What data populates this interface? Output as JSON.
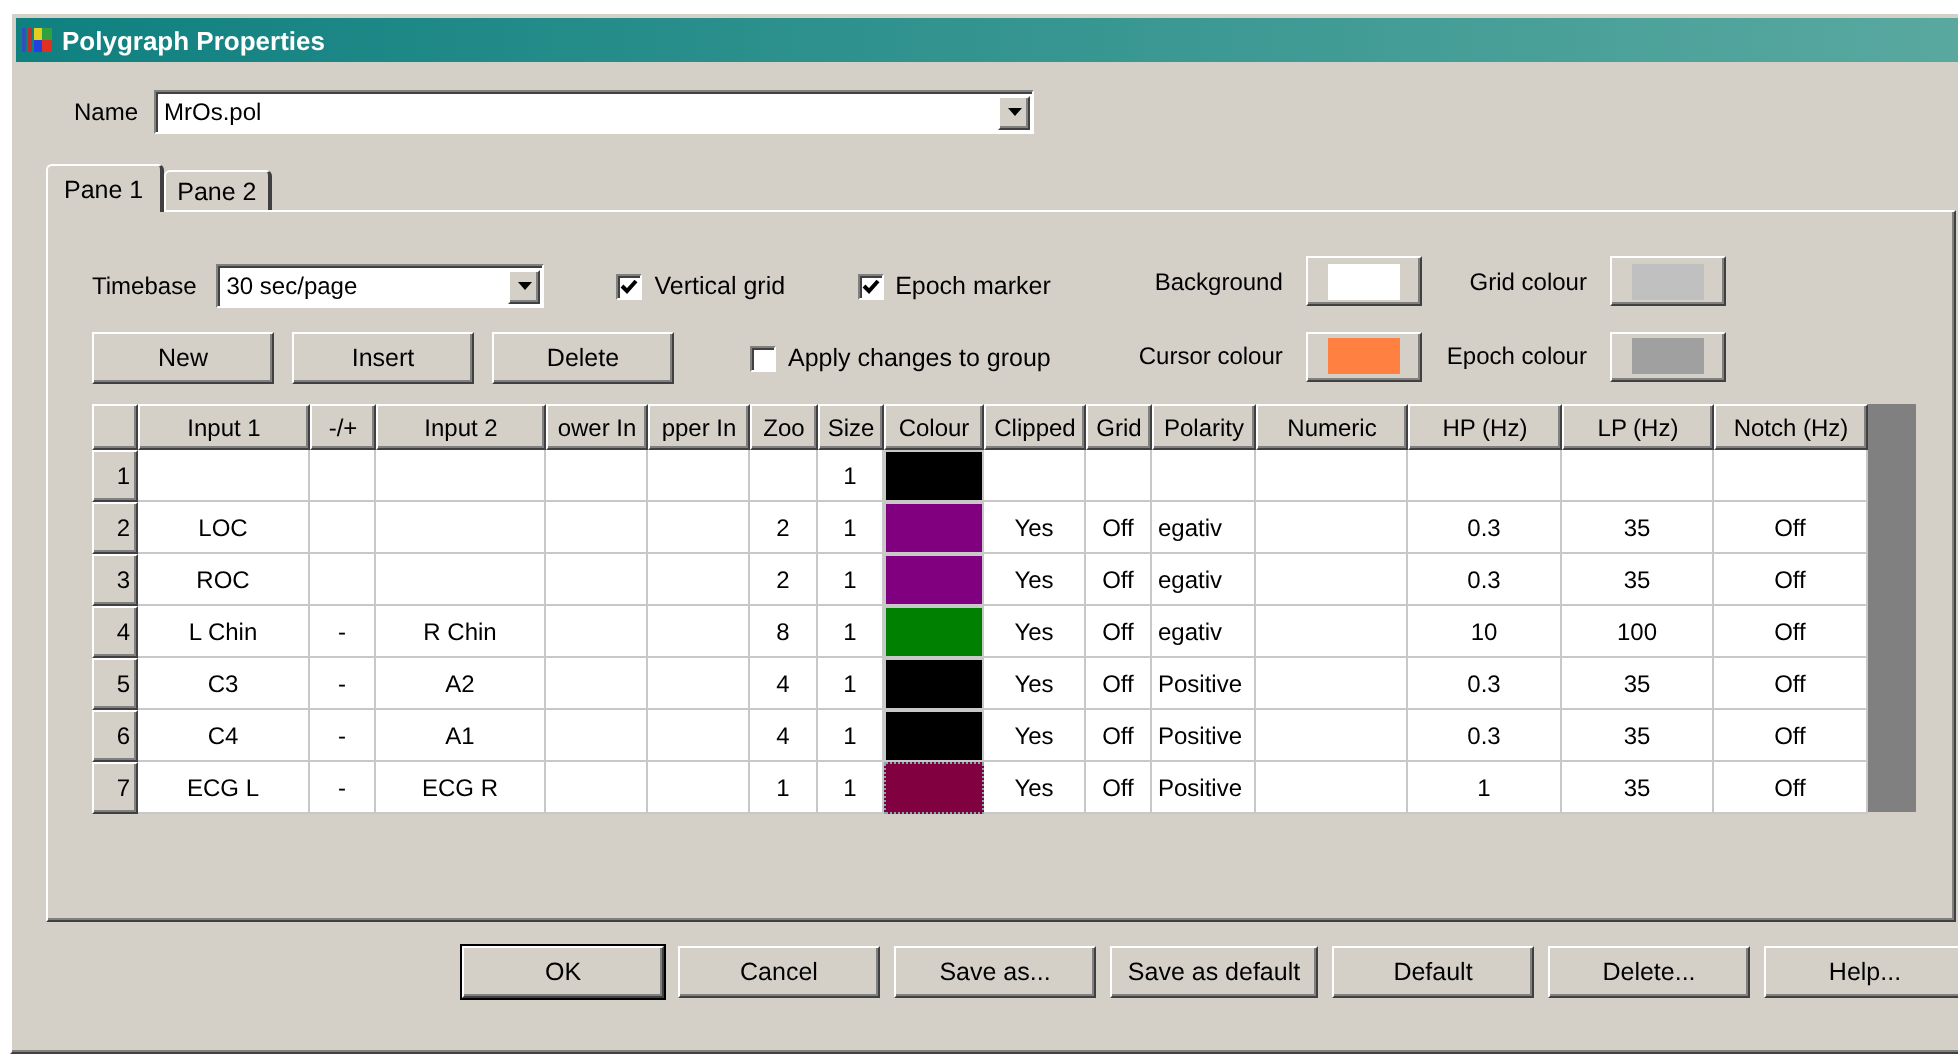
{
  "window": {
    "title": "Polygraph Properties"
  },
  "name_field": {
    "label": "Name",
    "value": "MrOs.pol"
  },
  "tabs": [
    {
      "label": "Pane 1",
      "selected": true
    },
    {
      "label": "Pane 2",
      "selected": false
    }
  ],
  "timebase": {
    "label": "Timebase",
    "value": "30 sec/page"
  },
  "checkboxes": [
    {
      "label": "Vertical grid",
      "checked": true
    },
    {
      "label": "Epoch marker",
      "checked": true
    },
    {
      "label": "Apply changes to group",
      "checked": false
    }
  ],
  "colour_settings": [
    {
      "label": "Background",
      "color": "#ffffff"
    },
    {
      "label": "Grid colour",
      "color": "#c0c0c0"
    },
    {
      "label": "Cursor colour",
      "color": "#ff8040"
    },
    {
      "label": "Epoch colour",
      "color": "#a0a0a0"
    }
  ],
  "row_buttons": [
    "New",
    "Insert",
    "Delete"
  ],
  "table": {
    "columns": [
      "Input 1",
      "-/+",
      "Input 2",
      "ower In",
      "pper In",
      "Zoo",
      "Size",
      "Colour",
      "Clipped",
      "Grid",
      "Polarity",
      "Numeric",
      "HP (Hz)",
      "LP (Hz)",
      "Notch (Hz)"
    ],
    "rows": [
      {
        "number": "1",
        "size": "1",
        "color": "#000000",
        "selected": false
      },
      {
        "number": "2",
        "input_1": "LOC",
        "zoom": "2",
        "size": "1",
        "color": "#800080",
        "clipped": "Yes",
        "grid": "Off",
        "polarity": "egativ",
        "hp": "0.3",
        "lp": "35",
        "notch": "Off",
        "selected": false
      },
      {
        "number": "3",
        "input_1": "ROC",
        "zoom": "2",
        "size": "1",
        "color": "#800080",
        "clipped": "Yes",
        "grid": "Off",
        "polarity": "egativ",
        "hp": "0.3",
        "lp": "35",
        "notch": "Off",
        "selected": false
      },
      {
        "number": "4",
        "input_1": "L Chin",
        "sign": "-",
        "input_2": "R Chin",
        "zoom": "8",
        "size": "1",
        "color": "#008000",
        "clipped": "Yes",
        "grid": "Off",
        "polarity": "egativ",
        "hp": "10",
        "lp": "100",
        "notch": "Off",
        "selected": false
      },
      {
        "number": "5",
        "input_1": "C3",
        "sign": "-",
        "input_2": "A2",
        "zoom": "4",
        "size": "1",
        "color": "#000000",
        "clipped": "Yes",
        "grid": "Off",
        "polarity": "Positive",
        "hp": "0.3",
        "lp": "35",
        "notch": "Off",
        "selected": false
      },
      {
        "number": "6",
        "input_1": "C4",
        "sign": "-",
        "input_2": "A1",
        "zoom": "4",
        "size": "1",
        "color": "#000000",
        "clipped": "Yes",
        "grid": "Off",
        "polarity": "Positive",
        "hp": "0.3",
        "lp": "35",
        "notch": "Off",
        "selected": false
      },
      {
        "number": "7",
        "input_1": "ECG L",
        "sign": "-",
        "input_2": "ECG R",
        "zoom": "1",
        "size": "1",
        "color": "#800040",
        "clipped": "Yes",
        "grid": "Off",
        "polarity": "Positive",
        "hp": "1",
        "lp": "35",
        "notch": "Off",
        "selected": true
      }
    ]
  },
  "buttons": [
    {
      "label": "OK",
      "default": true
    },
    {
      "label": "Cancel",
      "default": false
    },
    {
      "label": "Save as...",
      "default": false
    },
    {
      "label": "Save as default",
      "default": false
    },
    {
      "label": "Default",
      "default": false
    },
    {
      "label": "Delete...",
      "default": false
    },
    {
      "label": "Help...",
      "default": false
    }
  ]
}
